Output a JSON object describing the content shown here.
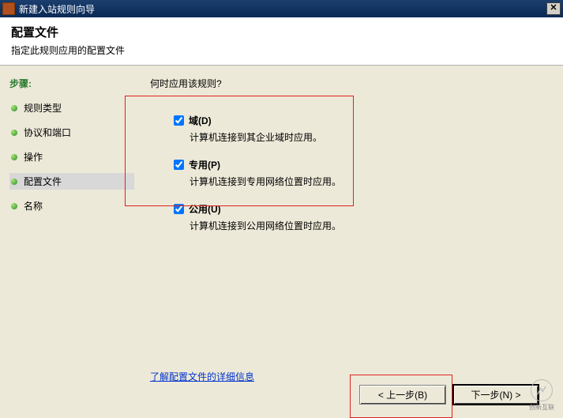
{
  "titlebar": {
    "title": "新建入站规则向导"
  },
  "banner": {
    "heading": "配置文件",
    "subtitle": "指定此规则应用的配置文件"
  },
  "sidebar": {
    "heading": "步骤:",
    "steps": [
      {
        "label": "规则类型"
      },
      {
        "label": "协议和端口"
      },
      {
        "label": "操作"
      },
      {
        "label": "配置文件"
      },
      {
        "label": "名称"
      }
    ]
  },
  "content": {
    "prompt": "何时应用该规则?",
    "options": [
      {
        "label": "域(D)",
        "desc": "计算机连接到其企业域时应用。"
      },
      {
        "label": "专用(P)",
        "desc": "计算机连接到专用网络位置时应用。"
      },
      {
        "label": "公用(U)",
        "desc": "计算机连接到公用网络位置时应用。"
      }
    ],
    "more_link": "了解配置文件的详细信息"
  },
  "footer": {
    "back": "< 上一步(B)",
    "next": "下一步(N) >"
  },
  "watermark": "创新互联"
}
